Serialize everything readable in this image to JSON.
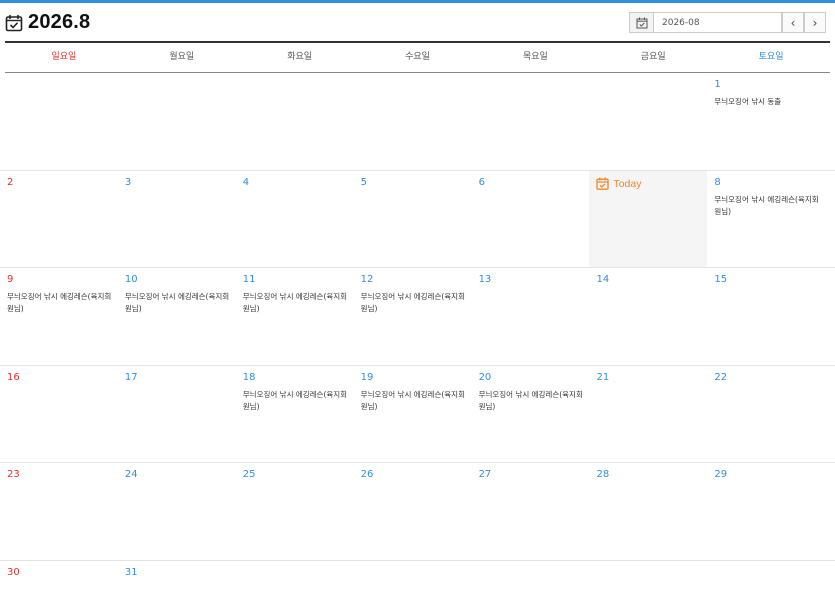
{
  "header": {
    "title": "2026.8",
    "title_icon": "calendar-check-icon",
    "month_value": "2026-08",
    "prev_label": "‹",
    "next_label": "›"
  },
  "weekdays": [
    "일요일",
    "월요일",
    "화요일",
    "수요일",
    "목요일",
    "금요일",
    "토요일"
  ],
  "today_label": "Today",
  "colors": {
    "accent": "#2f8fdc",
    "sunday": "#e0302e",
    "today": "#f0852b"
  },
  "weeks": [
    [
      {
        "day": "",
        "events": []
      },
      {
        "day": "",
        "events": []
      },
      {
        "day": "",
        "events": []
      },
      {
        "day": "",
        "events": []
      },
      {
        "day": "",
        "events": []
      },
      {
        "day": "",
        "events": []
      },
      {
        "day": "1",
        "events": [
          "무늬오징어 낚시 동출"
        ]
      }
    ],
    [
      {
        "day": "2",
        "events": []
      },
      {
        "day": "3",
        "events": []
      },
      {
        "day": "4",
        "events": []
      },
      {
        "day": "5",
        "events": []
      },
      {
        "day": "6",
        "events": []
      },
      {
        "day": "",
        "events": [],
        "today": true
      },
      {
        "day": "8",
        "events": [
          "무늬오징어 낚시 에깅레슨(육지회원님)"
        ]
      }
    ],
    [
      {
        "day": "9",
        "events": [
          "무늬오징어 낚시 에깅레슨(육지회원님)"
        ]
      },
      {
        "day": "10",
        "events": [
          "무늬오징어 낚시 에깅레슨(육지회원님)"
        ]
      },
      {
        "day": "11",
        "events": [
          "무늬오징어 낚시 에깅레슨(육지회원님)"
        ]
      },
      {
        "day": "12",
        "events": [
          "무늬오징어 낚시 에깅레슨(육지회원님)"
        ]
      },
      {
        "day": "13",
        "events": []
      },
      {
        "day": "14",
        "events": []
      },
      {
        "day": "15",
        "events": []
      }
    ],
    [
      {
        "day": "16",
        "events": []
      },
      {
        "day": "17",
        "events": []
      },
      {
        "day": "18",
        "events": [
          "무늬오징어 낚시 에깅레슨(육지회원님)"
        ]
      },
      {
        "day": "19",
        "events": [
          "무늬오징어 낚시 에깅레슨(육지회원님)"
        ]
      },
      {
        "day": "20",
        "events": [
          "무늬오징어 낚시 에깅레슨(육지회원님)"
        ]
      },
      {
        "day": "21",
        "events": []
      },
      {
        "day": "22",
        "events": []
      }
    ],
    [
      {
        "day": "23",
        "events": []
      },
      {
        "day": "24",
        "events": []
      },
      {
        "day": "25",
        "events": []
      },
      {
        "day": "26",
        "events": []
      },
      {
        "day": "27",
        "events": []
      },
      {
        "day": "28",
        "events": []
      },
      {
        "day": "29",
        "events": []
      }
    ],
    [
      {
        "day": "30",
        "events": []
      },
      {
        "day": "31",
        "events": []
      },
      {
        "day": "",
        "events": []
      },
      {
        "day": "",
        "events": []
      },
      {
        "day": "",
        "events": []
      },
      {
        "day": "",
        "events": []
      },
      {
        "day": "",
        "events": []
      }
    ]
  ]
}
